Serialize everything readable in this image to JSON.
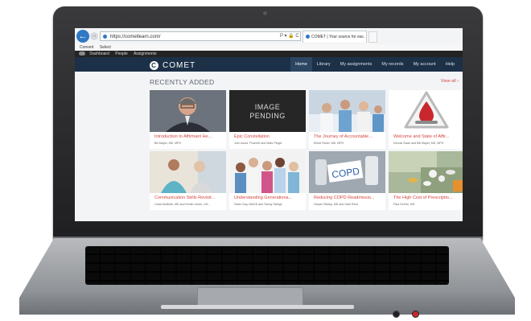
{
  "browser": {
    "url": "https://cometlearn.com/",
    "address_icons": "P ▾ 🔒 C",
    "tab_title": "COMET | Your source for ea...",
    "tab_close": "×",
    "back_icon": "←",
    "forward_icon": "→",
    "commands": [
      "Convert",
      "Select"
    ]
  },
  "app_toolbar": {
    "items": [
      "Dashboard",
      "People",
      "Assignments"
    ]
  },
  "site": {
    "brand": "COMET",
    "nav": [
      "Home",
      "Library",
      "My assignments",
      "My records",
      "My account",
      "Help"
    ],
    "active_nav": "Home"
  },
  "main": {
    "section_title": "RECENTLY ADDED",
    "view_all": "View all ›",
    "cards": [
      {
        "title": "Introduction to Affirmant He...",
        "authors": "Bill Mayer, MD, MPH"
      },
      {
        "title": "Epic Constellation",
        "authors": "Joel Jones, PharmD and Mark Pinger",
        "thumb_text": "IMAGE PENDING"
      },
      {
        "title": "The Journey of Accountable...",
        "authors": "Elliott Fisher, MD, MPH"
      },
      {
        "title": "Welcome and State of Affir...",
        "authors": "Dennis Swan and Bill Mayer, MD, MPH"
      },
      {
        "title": "Communication Skills Revisit...",
        "authors": "Linda McBride, MD and Kristin Jones, LM..."
      },
      {
        "title": "Understanding Generationa...",
        "authors": "Gwen Day, MAOD and Sanny Siebge"
      },
      {
        "title": "Reducing COPD Readmissio...",
        "authors": "Harper Siddiqi, MD and Vicki Rech"
      },
      {
        "title": "The High Cost of Prescriptio...",
        "authors": "Paul DeVito, MD"
      }
    ],
    "copd_label": "COPD"
  },
  "colors": {
    "accent": "#d2473f",
    "header": "#1c3047",
    "nav_active": "#2c4563"
  }
}
